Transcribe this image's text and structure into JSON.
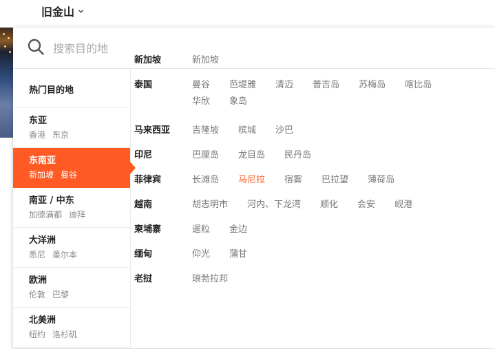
{
  "header": {
    "city": "旧金山"
  },
  "search": {
    "placeholder": "搜索目的地"
  },
  "sidebar": {
    "title": "热门目的地",
    "regions": [
      {
        "name": "东亚",
        "cities": [
          "香港",
          "东京"
        ]
      },
      {
        "name": "东南亚",
        "cities": [
          "新加坡",
          "曼谷"
        ],
        "active": true
      },
      {
        "name": "南亚 / 中东",
        "cities": [
          "加德满都",
          "迪拜"
        ]
      },
      {
        "name": "大洋洲",
        "cities": [
          "悉尼",
          "墨尔本"
        ]
      },
      {
        "name": "欧洲",
        "cities": [
          "伦敦",
          "巴黎"
        ]
      },
      {
        "name": "北美洲",
        "cities": [
          "纽约",
          "洛杉矶"
        ]
      }
    ]
  },
  "countries": [
    {
      "name": "新加坡",
      "cities": [
        "新加坡"
      ]
    },
    {
      "name": "泰国",
      "cities": [
        "曼谷",
        "芭堤雅",
        "清迈",
        "普吉岛",
        "苏梅岛",
        "喀比岛",
        "华欣",
        "象岛"
      ]
    },
    {
      "name": "马来西亚",
      "cities": [
        "吉隆坡",
        "槟城",
        "沙巴"
      ]
    },
    {
      "name": "印尼",
      "cities": [
        "巴厘岛",
        "龙目岛",
        "民丹岛"
      ]
    },
    {
      "name": "菲律宾",
      "cities": [
        "长滩岛",
        "马尼拉",
        "宿雾",
        "巴拉望",
        "薄荷岛"
      ]
    },
    {
      "name": "越南",
      "cities": [
        "胡志明市",
        "河内、下龙湾",
        "顺化",
        "会安",
        "岘港"
      ]
    },
    {
      "name": "柬埔寨",
      "cities": [
        "暹粒",
        "金边"
      ]
    },
    {
      "name": "缅甸",
      "cities": [
        "仰光",
        "蒲甘"
      ]
    },
    {
      "name": "老挝",
      "cities": [
        "琅勃拉邦"
      ]
    }
  ],
  "highlighted_city": "马尼拉",
  "colors": {
    "accent": "#ff5a24"
  },
  "icons": {
    "search": "search-icon",
    "city_dropdown": "chevron-down-icon"
  }
}
